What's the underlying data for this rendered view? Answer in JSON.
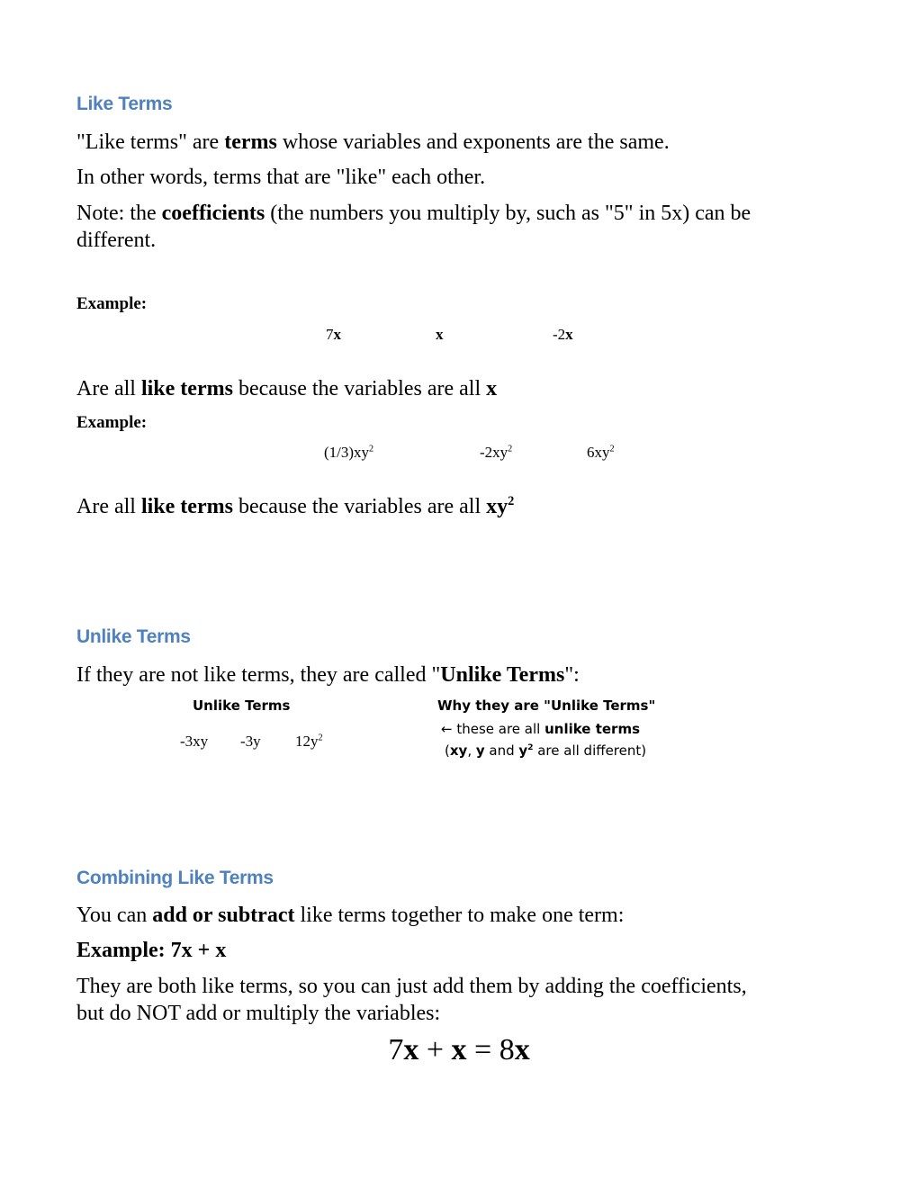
{
  "sections": {
    "like_terms": {
      "heading": "Like Terms",
      "line1_a": "\"Like terms\" are ",
      "line1_b": "terms",
      "line1_c": " whose variables and exponents are the same.",
      "line2": "In other words, terms that are \"like\" each other.",
      "line3_a": "Note: the ",
      "line3_b": "coefficients",
      "line3_c": " (the numbers you multiply by, such as \"5\" in 5x) can be",
      "line3_d": "different.",
      "example1": {
        "label": "Example:",
        "terms": [
          {
            "coef": "7",
            "var": "x"
          },
          {
            "coef": "",
            "var": "x"
          },
          {
            "coef": "-2",
            "var": "x"
          }
        ],
        "conclusion_a": "Are all ",
        "conclusion_b": "like terms",
        "conclusion_c": " because the variables are all ",
        "conclusion_d": "x"
      },
      "example2": {
        "label": "Example:",
        "terms": [
          {
            "coef": "(1/3)",
            "var": "xy",
            "exp": "2"
          },
          {
            "coef": "-2",
            "var": "xy",
            "exp": "2"
          },
          {
            "coef": "6",
            "var": "xy",
            "exp": "2"
          }
        ],
        "conclusion_a": "Are all ",
        "conclusion_b": "like terms",
        "conclusion_c": " because the variables are all ",
        "conclusion_d": "xy",
        "conclusion_exp": "2"
      }
    },
    "unlike_terms": {
      "heading": "Unlike Terms",
      "intro_a": "If they are not like terms, they are called \"",
      "intro_b": "Unlike Terms",
      "intro_c": "\":",
      "table": {
        "col1_header": "Unlike Terms",
        "col2_header": "Why they are \"Unlike Terms\"",
        "terms": [
          {
            "coef": "-3",
            "var": "xy",
            "exp": ""
          },
          {
            "coef": "-3",
            "var": "y",
            "exp": ""
          },
          {
            "coef": "12",
            "var": "y",
            "exp": "2"
          }
        ],
        "reason_line1_a": "← these are all ",
        "reason_line1_b": "unlike terms",
        "reason_line2_open": "(",
        "reason_line2_xy": "xy",
        "reason_line2_comma": ", ",
        "reason_line2_y": "y",
        "reason_line2_and": " and ",
        "reason_line2_y2": "y",
        "reason_line2_exp": "2",
        "reason_line2_rest": " are all different)"
      }
    },
    "combining": {
      "heading": "Combining Like Terms",
      "line1_a": "You can ",
      "line1_b": "add or subtract",
      "line1_c": " like terms together to make one term:",
      "example": "Example: 7x + x",
      "line3": "They are both like terms, so you can just add them by adding the coefficients,",
      "line4": "but do NOT add or multiply the variables:",
      "equation": {
        "c1": "7",
        "v1": "x",
        "op": " + ",
        "v2": "x",
        "eq": " = ",
        "c3": "8",
        "v3": "x"
      }
    }
  }
}
